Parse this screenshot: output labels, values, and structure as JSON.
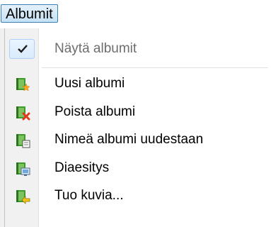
{
  "menu": {
    "title": "Albumit",
    "items": [
      {
        "label": "Näytä albumit",
        "icon": "check-icon",
        "checked": true
      },
      {
        "label": "Uusi albumi",
        "icon": "album-new-icon"
      },
      {
        "label": "Poista albumi",
        "icon": "album-delete-icon"
      },
      {
        "label": "Nimeä albumi uudestaan",
        "icon": "album-rename-icon"
      },
      {
        "label": "Diaesitys",
        "icon": "slideshow-icon"
      },
      {
        "label": "Tuo kuvia...",
        "icon": "import-icon"
      }
    ]
  },
  "colors": {
    "book_green": "#3f9a2d",
    "book_light": "#7cc25e",
    "star": "#f5a623",
    "delete_red": "#e03a1e",
    "highlight_border": "#3c7fb1"
  }
}
